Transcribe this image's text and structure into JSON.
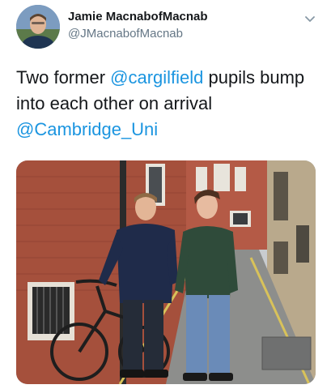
{
  "author": {
    "display_name": "Jamie MacnabofMacnab",
    "handle": "@JMacnabofMacnab",
    "avatar_icon": "person-avatar"
  },
  "tweet": {
    "mention_1": "@cargilfield",
    "text_middle": " pupils bump into each other on arrival",
    "text_before": "Two former ",
    "mention_2": "@Cambridge_Uni"
  },
  "menu_icon": "chevron-down-icon",
  "colors": {
    "link": "#1b95e0",
    "text": "#14171a",
    "secondary": "#657786"
  },
  "media": {
    "type": "photo"
  }
}
